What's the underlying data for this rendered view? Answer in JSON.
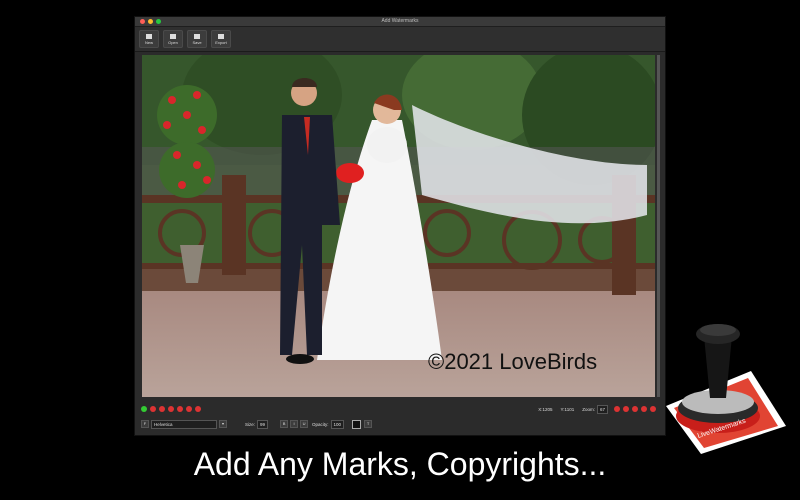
{
  "window": {
    "title": "Add Watermarks"
  },
  "toolbar": {
    "new": "New",
    "open": "Open",
    "save": "Save",
    "export": "Export"
  },
  "watermark": {
    "text": "©2021 LoveBirds"
  },
  "status": {
    "font": "Helvetica",
    "size_label": "Size:",
    "size_value": "99",
    "bold": "B",
    "italic": "I",
    "underline": "U",
    "opacity_label": "Opacity:",
    "opacity_value": "100",
    "x": "X:1205",
    "y": "Y:1101",
    "zoom_label": "Zoom:",
    "zoom_value": "67"
  },
  "caption": "Add Any Marks, Copyrights...",
  "stamp": {
    "label": "LiveWatermarks"
  },
  "colors": {
    "close": "#ff5f57",
    "minimize": "#febc2e",
    "zoom": "#28c840",
    "accent_red": "#d9322b"
  }
}
